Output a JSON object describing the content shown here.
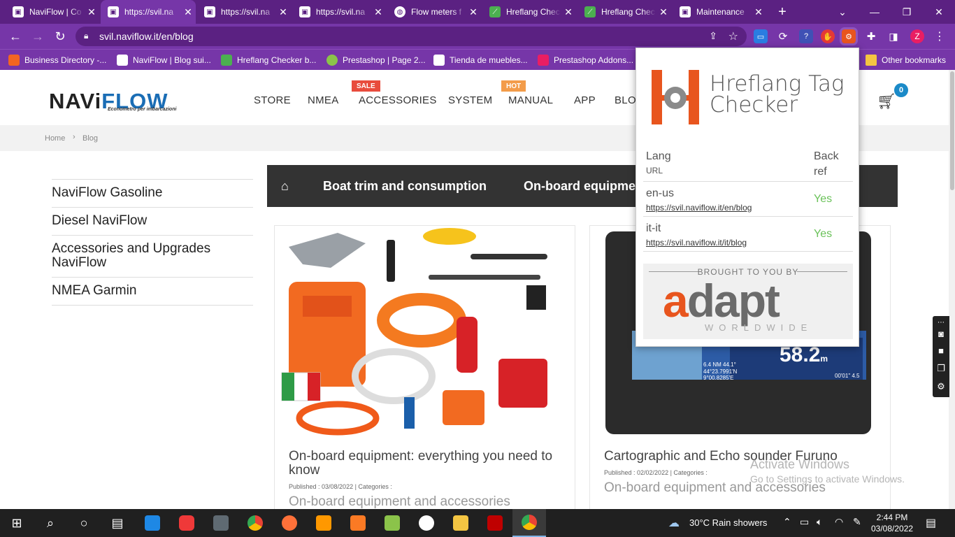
{
  "tabs": [
    {
      "label": "NaviFlow | Co",
      "icon": "naviflow-favicon"
    },
    {
      "label": "https://svil.na",
      "icon": "naviflow-favicon",
      "active": true
    },
    {
      "label": "https://svil.na",
      "icon": "naviflow-favicon"
    },
    {
      "label": "https://svil.na",
      "icon": "naviflow-favicon"
    },
    {
      "label": "Flow meters f",
      "icon": "globe-icon"
    },
    {
      "label": "Hreflang Chec",
      "icon": "hreflang-favicon"
    },
    {
      "label": "Hreflang Chec",
      "icon": "hreflang-favicon"
    },
    {
      "label": "Maintenance",
      "icon": "naviflow-favicon"
    }
  ],
  "address": {
    "url": "svil.naviflow.it/en/blog"
  },
  "bookmarks": [
    {
      "label": "Business Directory -...",
      "color": "#f26522"
    },
    {
      "label": "NaviFlow | Blog sui...",
      "color": "#ffffff"
    },
    {
      "label": "Hreflang Checker b...",
      "color": "#4caf50"
    },
    {
      "label": "Prestashop | Page 2...",
      "color": "#8bc34a"
    },
    {
      "label": "Tienda de muebles...",
      "color": "#ffffff"
    },
    {
      "label": "Prestashop Addons...",
      "color": "#e91e63"
    }
  ],
  "other_bookmarks": "Other bookmarks",
  "site": {
    "logo_navi": "NAVi",
    "logo_flow": "FLOW",
    "logo_tagline": "Econometro per imbarcazioni",
    "menu": [
      "STORE",
      "NMEA",
      "ACCESSORIES",
      "SYSTEM",
      "MANUAL",
      "APP",
      "BLO"
    ],
    "badge_sale": "SALE",
    "badge_hot": "HOT",
    "cart_count": "0",
    "breadcrumb": {
      "home": "Home",
      "current": "Blog"
    },
    "sidebar": [
      "NaviFlow Gasoline",
      "Diesel NaviFlow",
      "Accessories and Upgrades NaviFlow",
      "NMEA Garmin"
    ],
    "categories": [
      "Boat trim and consumption",
      "On-board equipme"
    ],
    "posts": [
      {
        "title": "On-board equipment: everything you need to know",
        "meta": "Published : 03/08/2022 | Categories :",
        "category": "On-board equipment and accessories"
      },
      {
        "title": "Cartographic and Echo sounder Furuno",
        "meta": "Published : 02/02/2022 | Categories :",
        "category": "On-board equipment and accessories"
      }
    ],
    "screen_readout": {
      "depth": "58.2",
      "unit": "m",
      "coords": "44°23.7991'N\n9°00.8285'E",
      "speed": "6.4 NM 44.1°",
      "time": "00'01\" 4.5"
    }
  },
  "popup": {
    "title_line1": "Hreflang Tag",
    "title_line2": "Checker",
    "col_lang": "Lang",
    "col_url": "URL",
    "col_backref": "Back ref",
    "rows": [
      {
        "lang": "en-us",
        "url": "https://svil.naviflow.it/en/blog",
        "backref": "Yes"
      },
      {
        "lang": "it-it",
        "url": "https://svil.naviflow.it/it/blog",
        "backref": "Yes"
      }
    ],
    "brought": "BROUGHT TO YOU BY",
    "brand": "adapt",
    "brand_sub": "WORLDWIDE"
  },
  "watermark": {
    "line1": "Activate Windows",
    "line2": "Go to Settings to activate Windows."
  },
  "taskbar": {
    "weather": "30°C  Rain showers",
    "time": "2:44 PM",
    "date": "03/08/2022"
  },
  "colors": {
    "tab_bg": "#5b2182",
    "toolbar_bg": "#7636a8",
    "yes_green": "#6ac259",
    "adapt_orange": "#e8551e",
    "adapt_gray": "#6b6b6b"
  }
}
